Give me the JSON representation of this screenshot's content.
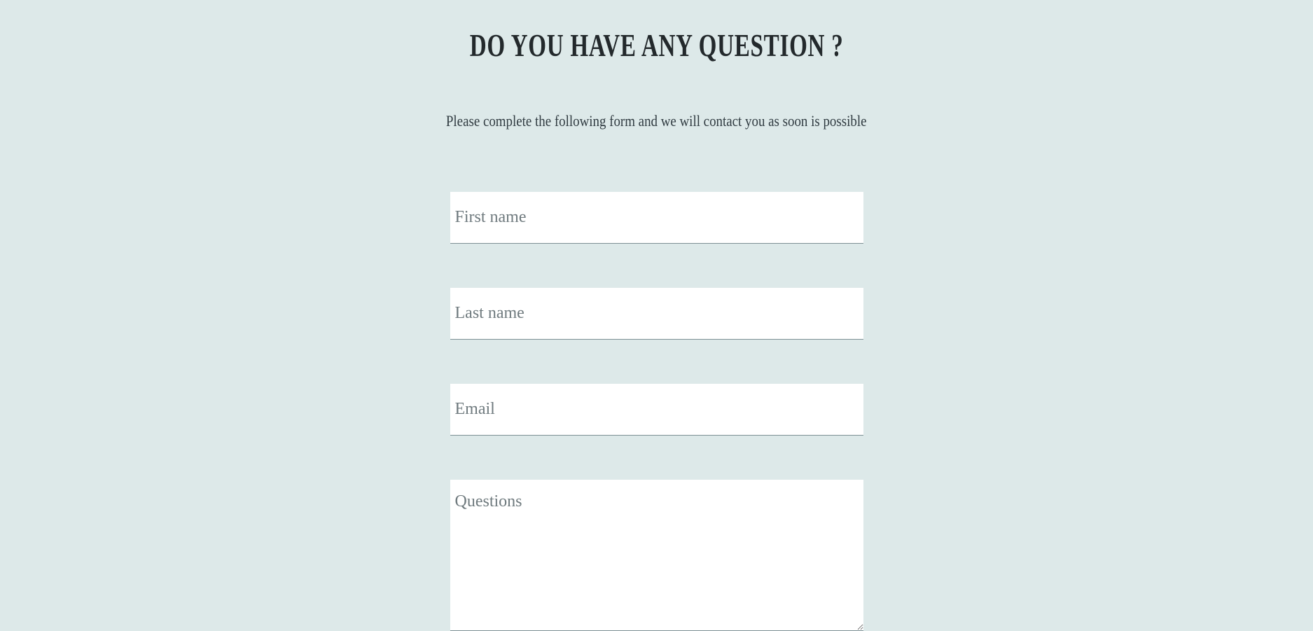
{
  "header": {
    "title": "DO YOU HAVE ANY QUESTION ?",
    "subtitle": "Please complete the following form and we will contact you as soon is possible"
  },
  "form": {
    "first_name": {
      "placeholder": "First name",
      "value": ""
    },
    "last_name": {
      "placeholder": "Last name",
      "value": ""
    },
    "email": {
      "placeholder": "Email",
      "value": ""
    },
    "questions": {
      "placeholder": "Questions",
      "value": ""
    }
  },
  "colors": {
    "background": "#dde9e9",
    "field_background": "#ffffff",
    "field_border": "#7c8f94",
    "text": "#23292c"
  }
}
